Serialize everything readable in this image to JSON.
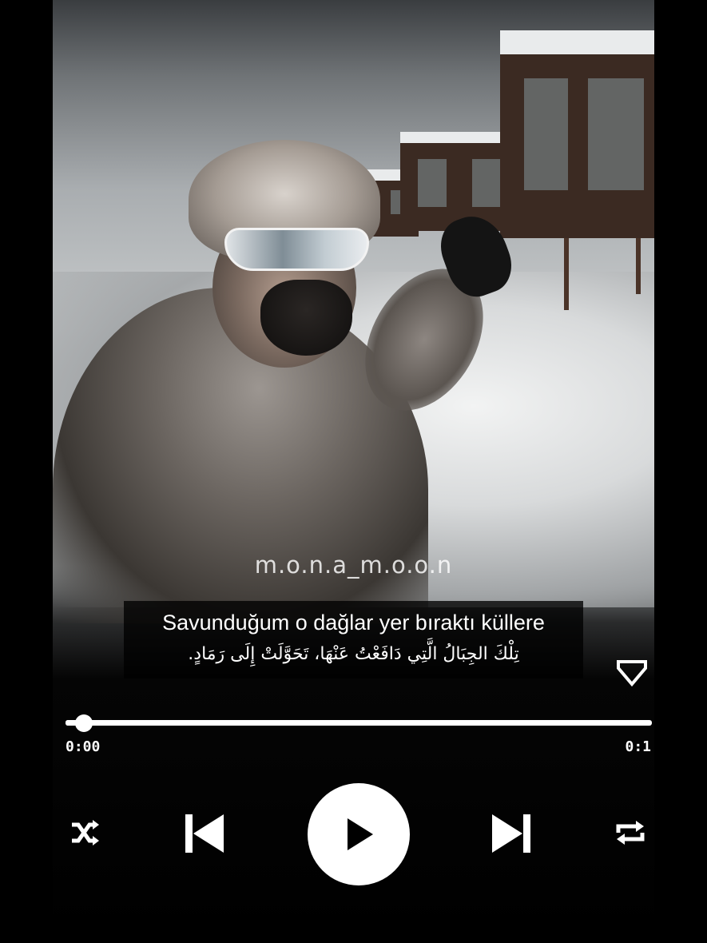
{
  "video": {
    "watermark": "m.o.n.a_m.o.o.n"
  },
  "lyrics": {
    "turkish": "Savunduğum o dağlar yer bıraktı küllere",
    "arabic": "تِلْكَ الجِبَالُ الَّتِي دَافَعْتُ عَنْهَا، تَحَوَّلَتْ إِلَى رَمَادٍ."
  },
  "player": {
    "elapsed": "0:00",
    "total": "0:1",
    "progress": 0.02,
    "is_playing": false,
    "controls": {
      "shuffle_icon": "shuffle-icon",
      "previous_icon": "skip-previous-icon",
      "play_icon": "play-icon",
      "next_icon": "skip-next-icon",
      "repeat_icon": "repeat-icon",
      "favorite_icon": "heart-icon"
    }
  },
  "colors": {
    "background": "#000000",
    "foreground": "#ffffff"
  }
}
